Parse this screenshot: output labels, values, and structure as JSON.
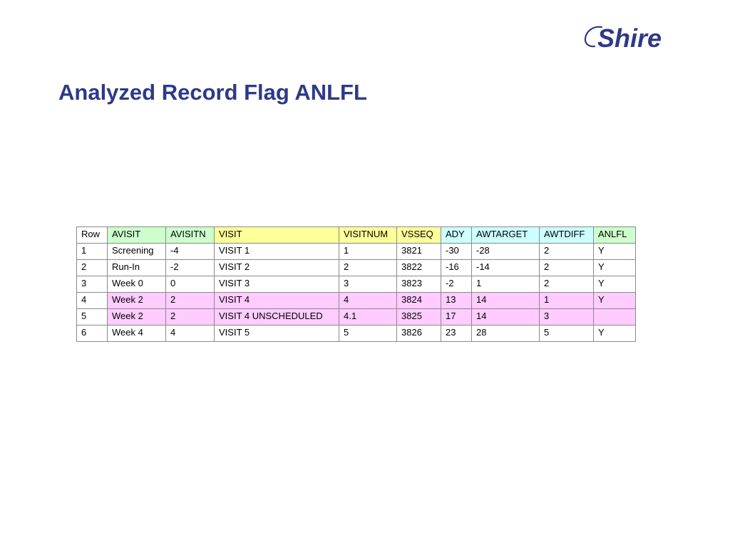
{
  "logo": {
    "text": "Shire",
    "color": "#2e3a87"
  },
  "title": "Analyzed Record Flag ANLFL",
  "colors": {
    "title": "#2e3a87",
    "header_green": "#ccffcc",
    "header_yellow": "#ffff99",
    "header_cyan": "#ccffff",
    "row_pink": "#ffccff"
  },
  "table": {
    "headers": [
      "Row",
      "AVISIT",
      "AVISITN",
      "VISIT",
      "VISITNUM",
      "VSSEQ",
      "ADY",
      "AWTARGET",
      "AWTDIFF",
      "ANLFL"
    ],
    "rows": [
      [
        "1",
        "Screening",
        "-4",
        "VISIT 1",
        "1",
        "3821",
        "-30",
        "-28",
        "2",
        "Y"
      ],
      [
        "2",
        "Run-In",
        "-2",
        "VISIT 2",
        "2",
        "3822",
        "-16",
        "-14",
        "2",
        "Y"
      ],
      [
        "3",
        "Week 0",
        "0",
        "VISIT 3",
        "3",
        "3823",
        "-2",
        "1",
        "2",
        "Y"
      ],
      [
        "4",
        "Week 2",
        "2",
        "VISIT 4",
        "4",
        "3824",
        "13",
        "14",
        "1",
        "Y"
      ],
      [
        "5",
        "Week 2",
        "2",
        "VISIT 4 UNSCHEDULED",
        "4.1",
        "3825",
        "17",
        "14",
        "3",
        ""
      ],
      [
        "6",
        "Week 4",
        "4",
        "VISIT 5",
        "5",
        "3826",
        "23",
        "28",
        "5",
        "Y"
      ]
    ],
    "highlighted_rows": [
      4,
      5
    ]
  }
}
